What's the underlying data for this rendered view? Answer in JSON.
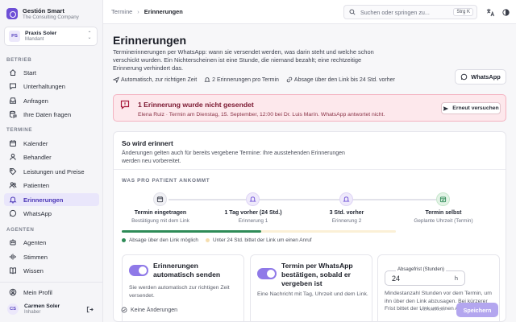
{
  "brand": {
    "name": "Gestión Smart",
    "subtitle": "The Consulting Company"
  },
  "tenant": {
    "initials": "PS",
    "name": "Praxis Soler",
    "role": "Mandant"
  },
  "sidebar": {
    "sections": [
      {
        "label": "BETRIEB",
        "items": [
          {
            "label": "Start",
            "icon": "home-icon"
          },
          {
            "label": "Unterhaltungen",
            "icon": "chat-bubble-icon"
          },
          {
            "label": "Anfragen",
            "icon": "inbox-icon"
          },
          {
            "label": "Ihre Daten fragen",
            "icon": "database-chat-icon"
          }
        ]
      },
      {
        "label": "TERMINE",
        "items": [
          {
            "label": "Kalender",
            "icon": "calendar-icon"
          },
          {
            "label": "Behandler",
            "icon": "person-icon"
          },
          {
            "label": "Leistungen und Preise",
            "icon": "tag-icon"
          },
          {
            "label": "Patienten",
            "icon": "users-icon"
          },
          {
            "label": "Erinnerungen",
            "icon": "bell-icon",
            "active": true
          },
          {
            "label": "WhatsApp",
            "icon": "whatsapp-icon"
          }
        ]
      },
      {
        "label": "AGENTEN",
        "items": [
          {
            "label": "Agenten",
            "icon": "robot-icon"
          },
          {
            "label": "Stimmen",
            "icon": "waveform-icon"
          },
          {
            "label": "Wissen",
            "icon": "book-icon"
          }
        ]
      }
    ],
    "profile_label": "Mein Profil",
    "user": {
      "initials": "CS",
      "name": "Carmen Soler",
      "role": "Inhaber"
    }
  },
  "topbar": {
    "breadcrumb": [
      "Termine",
      "Erinnerungen"
    ],
    "search_placeholder": "Suchen oder springen zu...",
    "shortcut": "Strg K"
  },
  "page": {
    "title": "Erinnerungen",
    "description": "Terminerinnerungen per WhatsApp: wann sie versendet werden, was darin steht und welche schon verschickt wurden. Ein Nichterscheinen ist eine Stunde, die niemand bezahlt; eine rechtzeitige Erinnerung verhindert das.",
    "chips": [
      {
        "label": "Automatisch, zur richtigen Zeit",
        "icon": "send-icon"
      },
      {
        "label": "2 Erinnerungen pro Termin",
        "icon": "bell-icon"
      },
      {
        "label": "Absage über den Link bis 24 Std. vorher",
        "icon": "link-icon"
      }
    ],
    "whatsapp_button": "WhatsApp"
  },
  "alert": {
    "title": "1 Erinnerung wurde nicht gesendet",
    "text": "Elena Ruiz · Termin am Dienstag, 15. September, 12:00 bei Dr. Luis Marín. WhatsApp antwortet nicht.",
    "action": "Erneut versuchen",
    "color": "#fde8ec"
  },
  "how": {
    "title": "So wird erinnert",
    "subtitle": "Änderungen gelten auch für bereits vergebene Termine: Ihre ausstehenden Erinnerungen werden neu vorbereitet.",
    "section_label": "WAS PRO PATIENT ANKOMMT",
    "steps": [
      {
        "title": "Termin eingetragen",
        "sub": "Bestätigung mit dem Link",
        "icon": "calendar-icon"
      },
      {
        "title": "1 Tag vorher (24 Std.)",
        "sub": "Erinnerung 1",
        "icon": "bell-icon"
      },
      {
        "title": "3 Std. vorher",
        "sub": "Erinnerung 2",
        "icon": "bell-icon"
      },
      {
        "title": "Termin selbst",
        "sub": "Geplante Uhrzeit (Termin)",
        "icon": "calendar-check-icon"
      }
    ],
    "cancel_window_fraction": 0.51,
    "legend": [
      {
        "label": "Absage über den Link möglich",
        "color": "#2e8b57"
      },
      {
        "label": "Unter 24 Std. bittet der Link um einen Anruf",
        "color": "#f5deb0"
      }
    ]
  },
  "options": {
    "auto_send": {
      "title": "Erinnerungen automatisch senden",
      "desc": "Sie werden automatisch zur richtigen Zeit versendet.",
      "enabled": true
    },
    "confirm": {
      "title": "Termin per WhatsApp bestätigen, sobald er vergeben ist",
      "desc": "Eine Nachricht mit Tag, Uhrzeit und dem Link.",
      "enabled": true
    },
    "deadline": {
      "label": "Absagefrist (Stunden)",
      "value": "24",
      "unit": "h",
      "desc": "Mindestanzahl Stunden vor dem Termin, um ihn über den Link abzusagen. Bei kürzerer Frist bittet der Link um einen Anruf."
    }
  },
  "footer": {
    "status": "Keine Änderungen",
    "discard": "Verwerfen",
    "save": "Speichern"
  }
}
